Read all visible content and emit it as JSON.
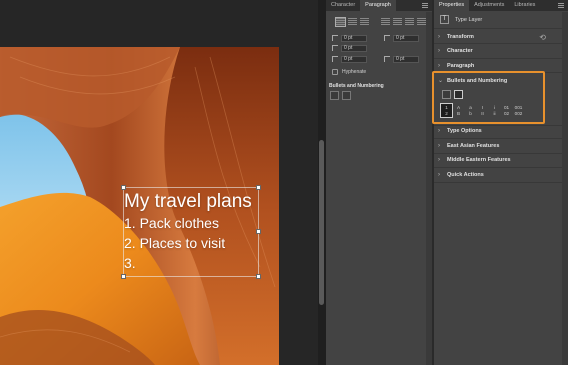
{
  "canvas": {
    "text": {
      "title": "My travel plans",
      "lines": [
        "1. Pack clothes",
        "2. Places to visit",
        "3."
      ]
    }
  },
  "paragraph_panel": {
    "tabs": [
      "Character",
      "Paragraph"
    ],
    "active_tab": "Paragraph",
    "indent_fields": [
      "0 pt",
      "0 pt",
      "0 pt",
      "0 pt",
      "0 pt"
    ],
    "hyphenate_label": "Hyphenate",
    "bullets_label": "Bullets and Numbering"
  },
  "properties_panel": {
    "tabs": [
      "Properties",
      "Adjustments",
      "Libraries"
    ],
    "active_tab": "Properties",
    "layer_type": "Type Layer",
    "sections": {
      "transform": "Transform",
      "character": "Character",
      "paragraph": "Paragraph",
      "bullets": "Bullets and Numbering",
      "type_options": "Type Options",
      "east_asian": "East Asian Features",
      "middle_eastern": "Middle Eastern Features",
      "quick_actions": "Quick Actions"
    },
    "numbering_styles": [
      {
        "top": "1",
        "bottom": "2"
      },
      {
        "top": "A",
        "bottom": "B"
      },
      {
        "top": "a",
        "bottom": "b"
      },
      {
        "top": "I",
        "bottom": "II"
      },
      {
        "top": "i",
        "bottom": "ii"
      },
      {
        "top": "01",
        "bottom": "02"
      },
      {
        "top": "001",
        "bottom": "002"
      }
    ],
    "highlight_color": "#e8912d"
  }
}
